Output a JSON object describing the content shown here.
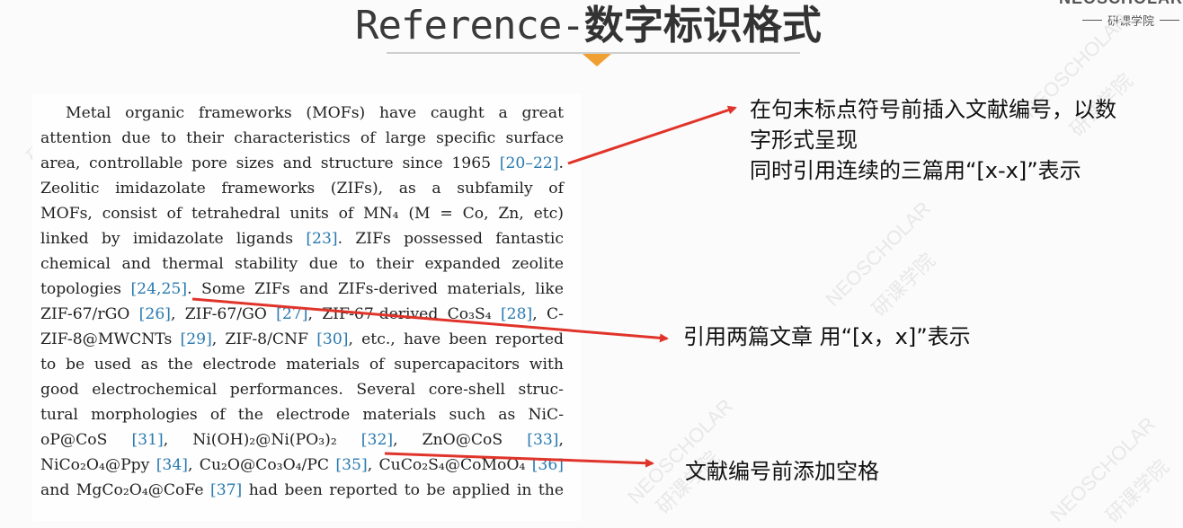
{
  "slide": {
    "title_en": "Reference-",
    "title_zh": "数字标识格式",
    "brand_name": "NEOSCHOLAR",
    "brand_sub": "研课学院",
    "watermark_en": "NEOSCHOLAR",
    "watermark_zh": "研课学院"
  },
  "paper": {
    "lines": [
      [
        "Metal organic frameworks (MOFs) have caught a great"
      ],
      [
        "attention due to their characteristics of large specific surface"
      ],
      [
        "area, controllable pore sizes and structure since 1965 ",
        {
          "cite": "[20–22]"
        },
        "."
      ],
      [
        "Zeolitic imidazolate frameworks (ZIFs), as a subfamily of"
      ],
      [
        "MOFs, consist of tetrahedral units of MN₄ (M = Co, Zn, etc)"
      ],
      [
        "linked by imidazolate ligands ",
        {
          "cite": "[23]"
        },
        ". ZIFs possessed fantastic"
      ],
      [
        "chemical and thermal stability due to their expanded zeolite"
      ],
      [
        "topologies ",
        {
          "cite": "[24,25]"
        },
        ". Some ZIFs and ZIFs-derived materials, like"
      ],
      [
        "ZIF-67/rGO ",
        {
          "cite": "[26]"
        },
        ", ZIF-67/GO ",
        {
          "cite": "[27]"
        },
        ", ZIF-67-derived Co₃S₄ ",
        {
          "cite": "[28]"
        },
        ", C-"
      ],
      [
        "ZIF-8@MWCNTs ",
        {
          "cite": "[29]"
        },
        ", ZIF-8/CNF ",
        {
          "cite": "[30]"
        },
        ", etc., have been reported"
      ],
      [
        "to be used as the electrode materials of supercapacitors with"
      ],
      [
        "good electrochemical performances. Several core-shell struc-"
      ],
      [
        "tural morphologies of the electrode materials such as NiC-"
      ],
      [
        "oP@CoS ",
        {
          "cite": "[31]"
        },
        ", Ni(OH)₂@Ni(PO₃)₂ ",
        {
          "cite": "[32]"
        },
        ", ZnO@CoS ",
        {
          "cite": "[33]"
        },
        ","
      ],
      [
        "NiCo₂O₄@Ppy ",
        {
          "cite": "[34]"
        },
        ", Cu₂O@Co₃O₄/PC ",
        {
          "cite": "[35]"
        },
        ", CuCo₂S₄@CoMoO₄ ",
        {
          "cite": "[36]"
        }
      ],
      [
        "and MgCo₂O₄@CoFe ",
        {
          "cite": "[37]"
        },
        " had been reported to be applied in the"
      ]
    ]
  },
  "notes": {
    "note1_line1": "在句末标点符号前插入文献编号，以数",
    "note1_line2": "字形式呈现",
    "note1_line3": "同时引用连续的三篇用“[x-x]”表示",
    "note2": "引用两篇文章 用“[x，x]”表示",
    "note3": "文献编号前添加空格"
  },
  "colors": {
    "arrow": "#e0342a",
    "accent_triangle": "#f0a033",
    "citation": "#2a7ab0"
  }
}
